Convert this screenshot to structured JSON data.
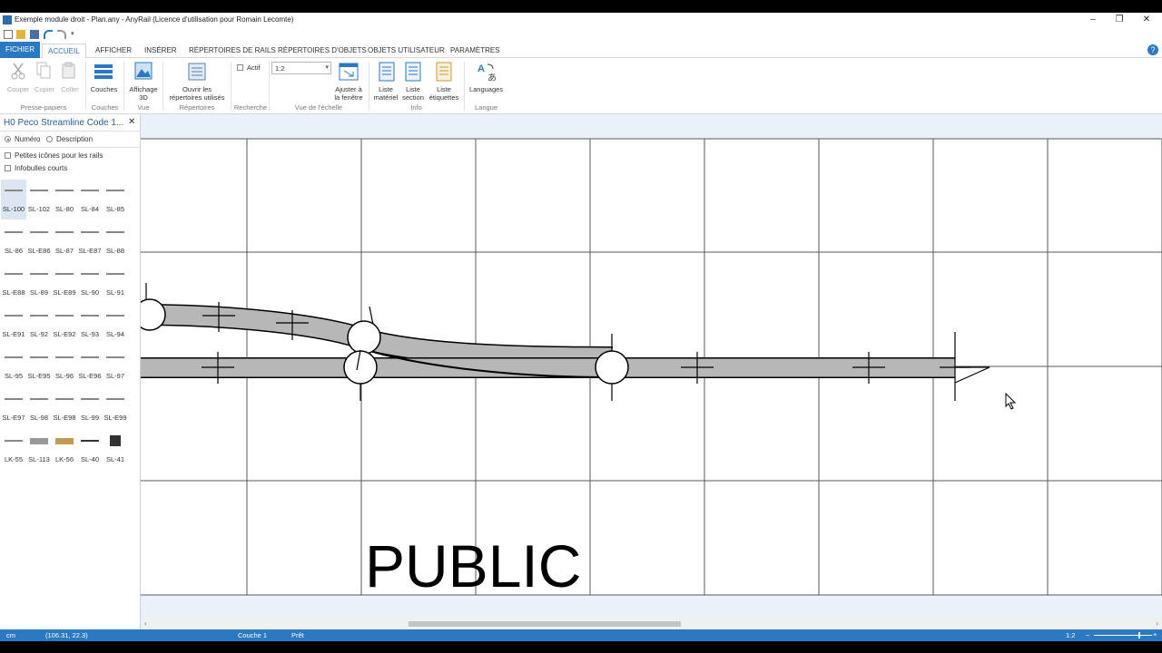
{
  "window": {
    "title": "Exemple module droit - Plan.any - AnyRail (Licence d'utilisation pour Romain Lecomte)",
    "minimize": "–",
    "restore": "❐",
    "close": "✕"
  },
  "tabs": [
    "FICHIER",
    "ACCUEIL",
    "AFFICHER",
    "INSÉRER",
    "RÉPERTOIRES DE RAILS",
    "RÉPERTOIRES D'OBJETS",
    "OBJETS UTILISATEUR",
    "PARAMÈTRES"
  ],
  "active_tab": "ACCUEIL",
  "help": "?",
  "ribbon": {
    "couper": "Couper",
    "copier": "Copier",
    "coller": "Coller",
    "presse_papiers": "Presse-papiers",
    "couches": "Couches",
    "couches_group": "Couches",
    "affichage_3d_1": "Affichage",
    "affichage_3d_2": "3D",
    "vue": "Vue",
    "ouvrir_1": "Ouvrir les",
    "ouvrir_2": "répertoires utilisés",
    "repertoires": "Répertoires",
    "actif": "Actif",
    "recherche": "Recherche",
    "scale_value": "1:2",
    "ajuster_1": "Ajuster à",
    "ajuster_2": "la fenêtre",
    "vue_echelle": "Vue de l'échelle",
    "liste_materiel_1": "Liste",
    "liste_materiel_2": "matériel",
    "liste_section_1": "Liste",
    "liste_section_2": "section",
    "liste_etiquettes_1": "Liste",
    "liste_etiquettes_2": "étiquettes",
    "info": "Info",
    "languages": "Languages",
    "langue": "Langue"
  },
  "panel": {
    "title": "H0 Peco Streamline Code 1...",
    "close": "✕",
    "radio_numero": "Numéro",
    "radio_description": "Description",
    "check_petites": "Petites icônes pour les rails",
    "check_infobulles": "Infobulles courts",
    "rails": [
      [
        "SL-100",
        "SL-102",
        "SL-80",
        "SL-84",
        "SL-85"
      ],
      [
        "SL-86",
        "SL-E86",
        "SL-87",
        "SL-E87",
        "SL-88"
      ],
      [
        "SL-E88",
        "SL-89",
        "SL-E89",
        "SL-90",
        "SL-91"
      ],
      [
        "SL-E91",
        "SL-92",
        "SL-E92",
        "SL-93",
        "SL-94"
      ],
      [
        "SL-95",
        "SL-E95",
        "SL-96",
        "SL-E96",
        "SL-97"
      ],
      [
        "SL-E97",
        "SL-98",
        "SL-E98",
        "SL-99",
        "SL-E99"
      ],
      [
        "LK-55",
        "SL-113",
        "LK-56",
        "SL-40",
        "SL-41"
      ]
    ]
  },
  "canvas": {
    "label": "PUBLIC"
  },
  "status": {
    "unit": "cm",
    "coords": "(106.31, 22.3)",
    "layer": "Couche 1",
    "state": "Prêt",
    "zoom": "1:2"
  }
}
